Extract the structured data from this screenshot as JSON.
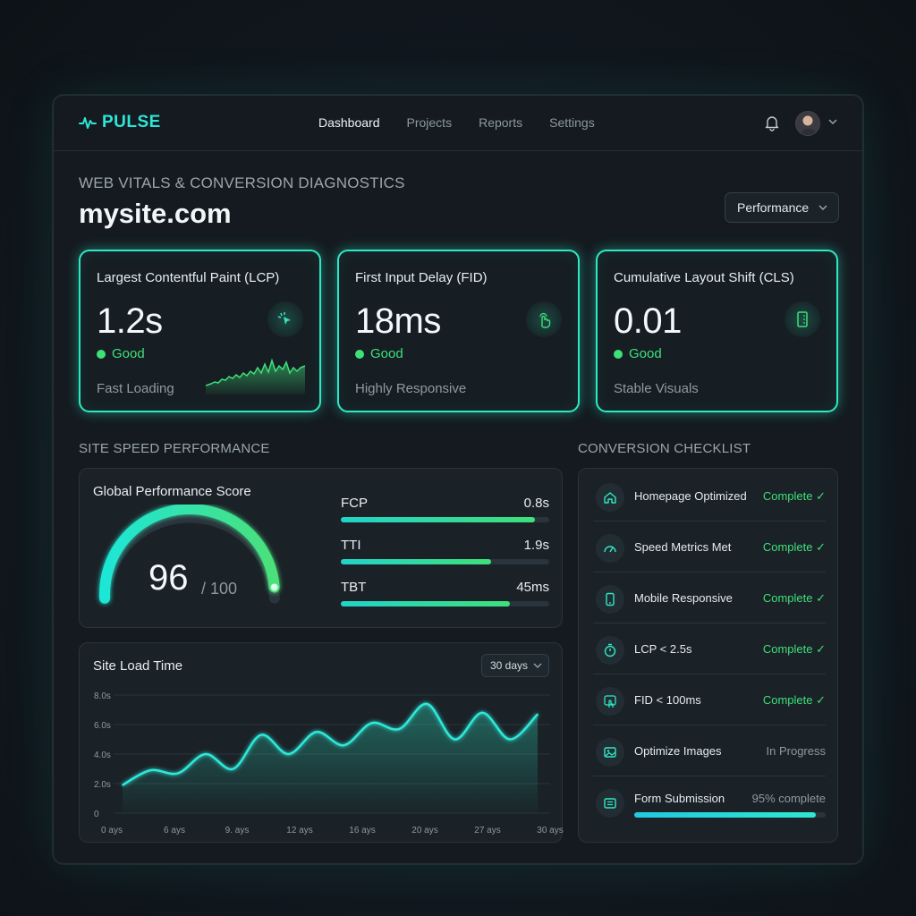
{
  "app": {
    "name": "PULSE"
  },
  "nav": {
    "items": [
      "Dashboard",
      "Projects",
      "Reports",
      "Settings"
    ],
    "active": "Dashboard"
  },
  "header": {
    "eyebrow": "WEB VITALS & CONVERSION DIAGNOSTICS",
    "site": "mysite.com",
    "filter": "Performance"
  },
  "vitals": [
    {
      "label": "Largest Contentful Paint (LCP)",
      "value": "1.2s",
      "status": "Good",
      "desc": "Fast Loading",
      "icon": "cursor-click-icon"
    },
    {
      "label": "First Input Delay (FID)",
      "value": "18ms",
      "status": "Good",
      "desc": "Highly Responsive",
      "icon": "tap-hand-icon"
    },
    {
      "label": "Cumulative Layout Shift (CLS)",
      "value": "0.01",
      "status": "Good",
      "desc": "Stable Visuals",
      "icon": "layout-frame-icon"
    }
  ],
  "speed": {
    "section_title": "SITE SPEED PERFORMANCE",
    "score_title": "Global Performance Score",
    "score": "96",
    "score_max": "/ 100",
    "score_fraction": 0.96,
    "metrics": [
      {
        "name": "FCP",
        "value": "0.8s",
        "fill": 0.93
      },
      {
        "name": "TTI",
        "value": "1.9s",
        "fill": 0.72
      },
      {
        "name": "TBT",
        "value": "45ms",
        "fill": 0.81
      }
    ]
  },
  "load_time": {
    "title": "Site Load Time",
    "range": "30 days"
  },
  "chart_data": {
    "type": "area",
    "title": "Site Load Time",
    "xlabel": "",
    "ylabel": "",
    "y_ticks": [
      "8.0s",
      "6.0s",
      "4.0s",
      "2.0s",
      "0"
    ],
    "x_ticks": [
      "0 ays",
      "6 ays",
      "9. ays",
      "12 ays",
      "16 ays",
      "20 ays",
      "27 ays",
      "30 ays"
    ],
    "ylim": [
      0,
      8
    ],
    "xlim": [
      0,
      30
    ],
    "grid": true,
    "series": [
      {
        "x": [
          0,
          2,
          4,
          6,
          8,
          10,
          12,
          14,
          16,
          18,
          20,
          22,
          24,
          26,
          28,
          30
        ],
        "values": [
          1.9,
          2.9,
          2.7,
          4.0,
          3.0,
          5.3,
          4.0,
          5.5,
          4.6,
          6.1,
          5.7,
          7.4,
          5.0,
          6.8,
          5.0,
          6.7
        ]
      }
    ]
  },
  "checklist": {
    "title": "CONVERSION CHECKLIST",
    "items": [
      {
        "label": "Homepage Optimized",
        "status": "Complete ✓",
        "icon": "home-icon"
      },
      {
        "label": "Speed Metrics Met",
        "status": "Complete ✓",
        "icon": "speedometer-icon"
      },
      {
        "label": "Mobile Responsive",
        "status": "Complete ✓",
        "icon": "mobile-phone-icon"
      },
      {
        "label": "LCP < 2.5s",
        "status": "Complete ✓",
        "icon": "stopwatch-icon"
      },
      {
        "label": "FID < 100ms",
        "status": "Complete ✓",
        "icon": "touch-icon"
      },
      {
        "label": "Optimize Images",
        "status": "In Progress",
        "icon": "image-icon"
      },
      {
        "label": "Form Submission",
        "status": "95% complete",
        "icon": "form-icon",
        "progress": 0.95
      }
    ]
  },
  "colors": {
    "accent": "#2de6d6",
    "good": "#3ee07a",
    "glow": "#2ee8c4"
  }
}
